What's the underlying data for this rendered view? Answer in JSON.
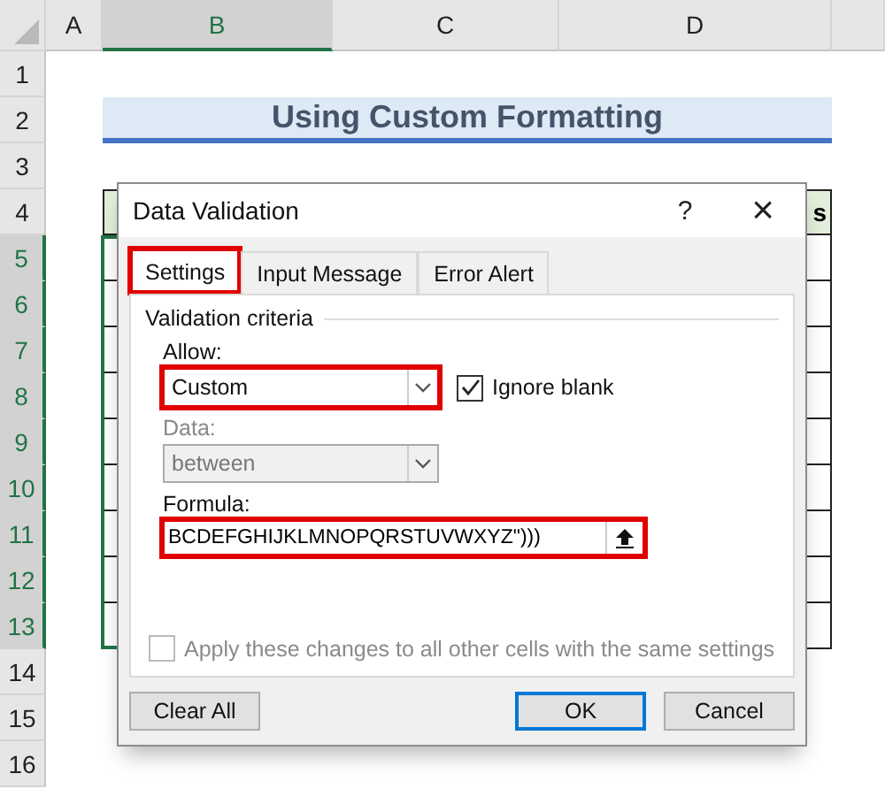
{
  "sheet": {
    "columns": [
      {
        "label": "A",
        "selected": false
      },
      {
        "label": "B",
        "selected": true
      },
      {
        "label": "C",
        "selected": false
      },
      {
        "label": "D",
        "selected": false
      }
    ],
    "rows": [
      {
        "label": "1",
        "selected": false
      },
      {
        "label": "2",
        "selected": false
      },
      {
        "label": "3",
        "selected": false
      },
      {
        "label": "4",
        "selected": false
      },
      {
        "label": "5",
        "selected": true
      },
      {
        "label": "6",
        "selected": true
      },
      {
        "label": "7",
        "selected": true
      },
      {
        "label": "8",
        "selected": true
      },
      {
        "label": "9",
        "selected": true
      },
      {
        "label": "10",
        "selected": true
      },
      {
        "label": "11",
        "selected": true
      },
      {
        "label": "12",
        "selected": true
      },
      {
        "label": "13",
        "selected": true
      },
      {
        "label": "14",
        "selected": false
      },
      {
        "label": "15",
        "selected": false
      },
      {
        "label": "16",
        "selected": false
      }
    ],
    "title": "Using Custom Formatting",
    "table_header_tail": "s"
  },
  "dialog": {
    "title": "Data Validation",
    "help": "?",
    "close": "×",
    "tabs": [
      {
        "label": "Settings",
        "selected": true,
        "highlighted": true
      },
      {
        "label": "Input Message",
        "selected": false,
        "highlighted": false
      },
      {
        "label": "Error Alert",
        "selected": false,
        "highlighted": false
      }
    ],
    "group_title": "Validation criteria",
    "allow": {
      "label": "Allow:",
      "value": "Custom",
      "disabled": false,
      "highlighted": true
    },
    "ignore_blank": {
      "label": "Ignore blank",
      "checked": true
    },
    "data": {
      "label": "Data:",
      "value": "between",
      "disabled": true,
      "highlighted": false
    },
    "formula": {
      "label": "Formula:",
      "value": "BCDEFGHIJKLMNOPQRSTUVWXYZ\")))",
      "highlighted": true
    },
    "apply_all": {
      "label": "Apply these changes to all other cells with the same settings",
      "checked": false,
      "disabled": true
    },
    "buttons": [
      {
        "label": "Clear All",
        "default": false
      },
      {
        "label": "OK",
        "default": true
      },
      {
        "label": "Cancel",
        "default": false
      }
    ]
  }
}
